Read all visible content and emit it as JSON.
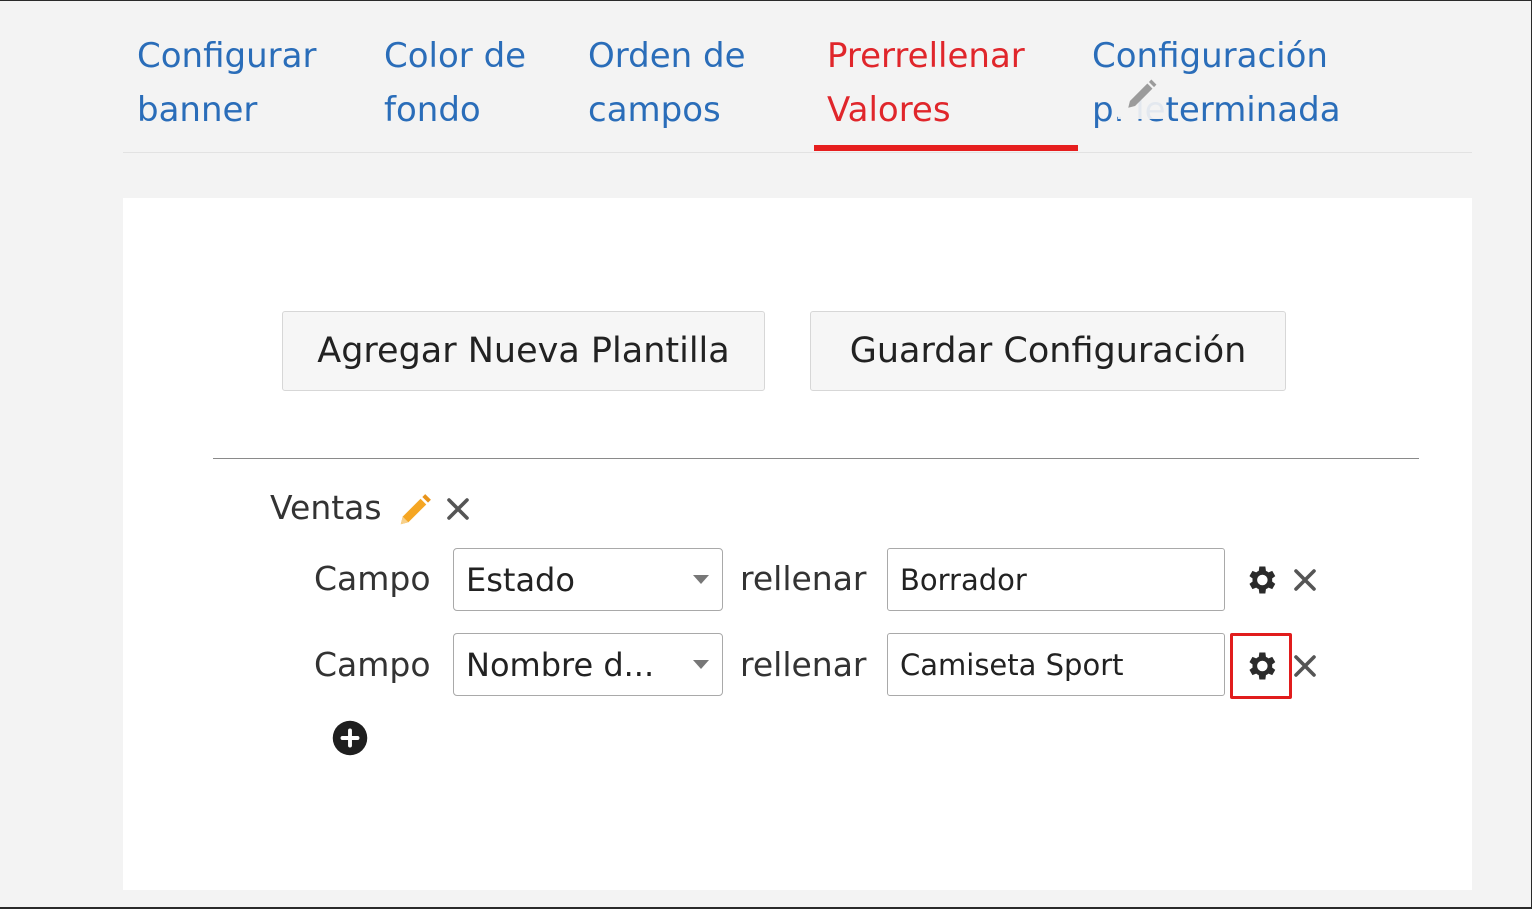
{
  "tabs": [
    {
      "line1": "Configurar",
      "line2": "banner"
    },
    {
      "line1": "Color de",
      "line2": "fondo"
    },
    {
      "line1": "Orden de",
      "line2": "campos"
    },
    {
      "line1": "Prerrellenar",
      "line2": "Valores"
    },
    {
      "line1": "Configuración",
      "line2": "p.  leterminada"
    }
  ],
  "active_tab": "Prerrellenar Valores",
  "toolbar": {
    "add_template_label": "Agregar Nueva Plantilla",
    "save_config_label": "Guardar Configuración"
  },
  "template": {
    "name": "Ventas",
    "rows": [
      {
        "field_label": "Campo",
        "field_value": "Estado",
        "fill_label": "rellenar",
        "fill_value": "Borrador"
      },
      {
        "field_label": "Campo",
        "field_value": "Nombre d...",
        "fill_label": "rellenar",
        "fill_value": "Camiseta Sport"
      }
    ]
  },
  "icons": {
    "edit": "pencil-icon",
    "delete": "close-icon",
    "settings": "gear-icon",
    "add": "plus-circle-icon"
  },
  "colors": {
    "link": "#2a6db9",
    "active": "#e0262b",
    "highlight": "#e11c1c",
    "pencil": "#f5a623"
  }
}
